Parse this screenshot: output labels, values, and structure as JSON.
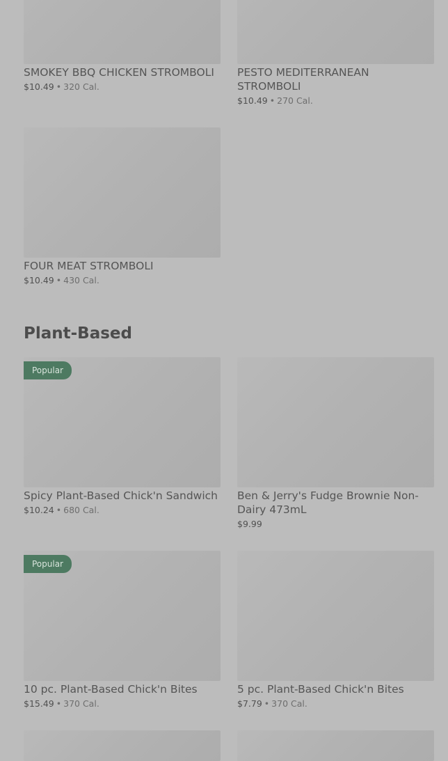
{
  "section": {
    "title": "Plant-Based"
  },
  "items": [
    {
      "name": "SMOKEY BBQ CHICKEN STROMBOLI",
      "price": "$10.49",
      "sep": "•",
      "calories": "320 Cal.",
      "badge": ""
    },
    {
      "name": "PESTO MEDITERRANEAN STROMBOLI",
      "price": "$10.49",
      "sep": "•",
      "calories": "270 Cal.",
      "badge": ""
    },
    {
      "name": "FOUR MEAT STROMBOLI",
      "price": "$10.49",
      "sep": "•",
      "calories": "430 Cal.",
      "badge": ""
    },
    {
      "name": "Spicy Plant-Based Chick'n Sandwich",
      "price": "$10.24",
      "sep": "•",
      "calories": "680 Cal.",
      "badge": "Popular"
    },
    {
      "name": "Ben & Jerry's Fudge Brownie Non-Dairy 473mL",
      "price": "$9.99",
      "sep": "",
      "calories": "",
      "badge": ""
    },
    {
      "name": "10 pc. Plant-Based Chick'n Bites",
      "price": "$15.49",
      "sep": "•",
      "calories": "370 Cal.",
      "badge": "Popular"
    },
    {
      "name": "5 pc. Plant-Based Chick'n Bites",
      "price": "$7.79",
      "sep": "•",
      "calories": "370 Cal.",
      "badge": ""
    }
  ]
}
